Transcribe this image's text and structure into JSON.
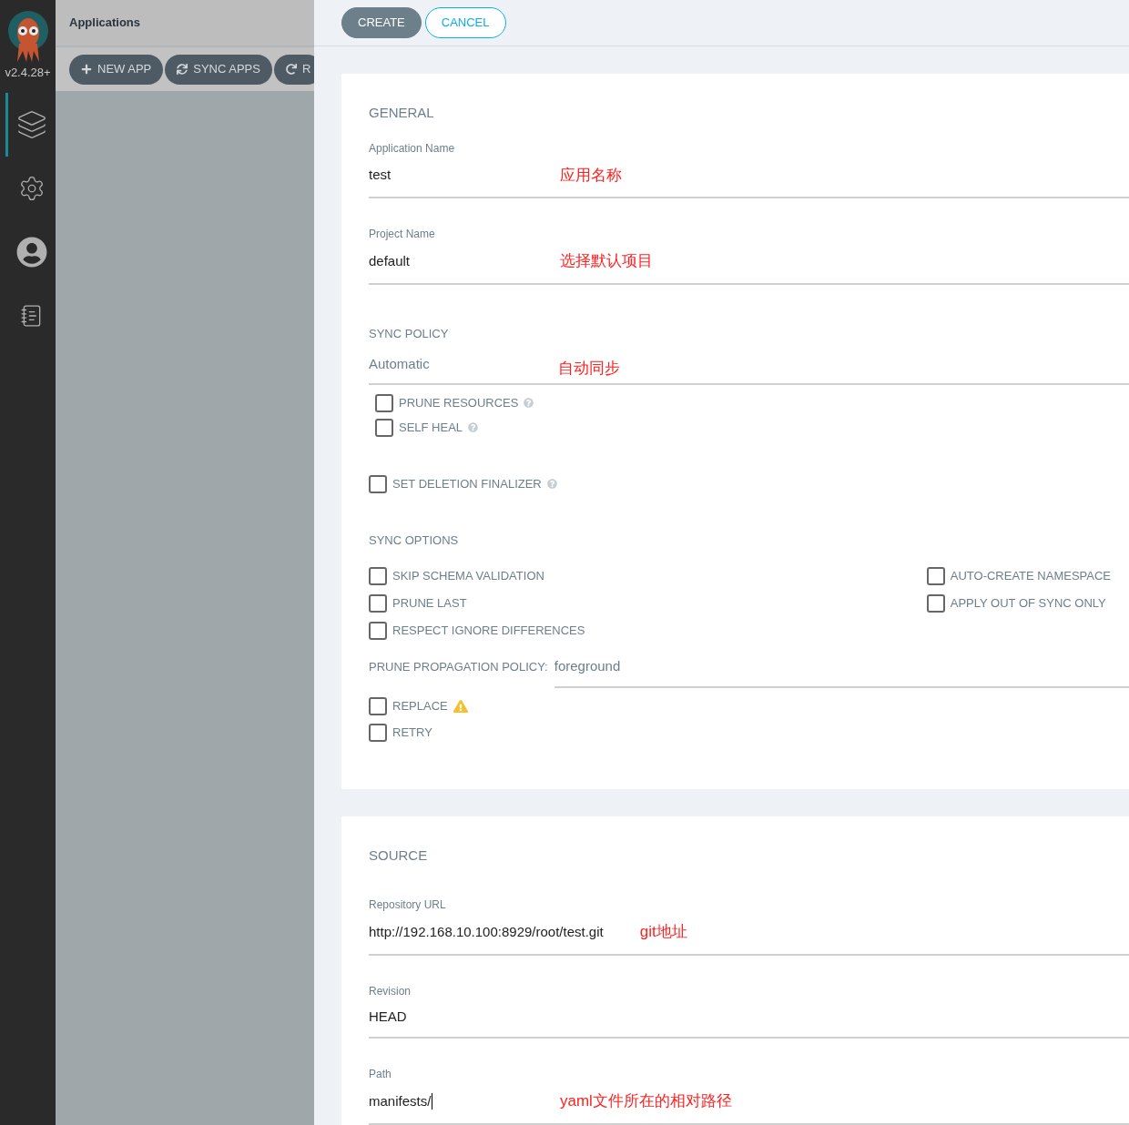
{
  "sidebar": {
    "version": "v2.4.28+",
    "nav_items": [
      {
        "kind": "layers",
        "selected": true
      },
      {
        "kind": "settings",
        "selected": false
      },
      {
        "kind": "user",
        "selected": false
      },
      {
        "kind": "docs",
        "selected": false
      }
    ]
  },
  "header": {
    "title": "Applications",
    "toolbar": [
      {
        "kind": "plus",
        "label": "NEW APP"
      },
      {
        "kind": "sync",
        "label": "SYNC APPS"
      },
      {
        "kind": "refresh",
        "label": "R"
      }
    ]
  },
  "actions": [
    {
      "kind": "primary",
      "label": "CREATE"
    },
    {
      "kind": "outline",
      "label": "CANCEL"
    }
  ],
  "general": {
    "title": "GENERAL",
    "fields": [
      {
        "label": "Application Name",
        "value": "test",
        "note": "应用名称",
        "focused": false
      },
      {
        "label": "Project Name",
        "value": "default",
        "note": "选择默认项目",
        "focused": false
      }
    ]
  },
  "sync_policy": {
    "title": "SYNC POLICY",
    "value": "Automatic",
    "note": "自动同步",
    "options": [
      {
        "label": "PRUNE RESOURCES",
        "checked": false
      },
      {
        "label": "SELF HEAL",
        "checked": false
      }
    ],
    "finalizer": {
      "label": "SET DELETION FINALIZER",
      "checked": false
    }
  },
  "sync_options": {
    "title": "SYNC OPTIONS",
    "left": [
      {
        "label": "SKIP SCHEMA VALIDATION",
        "checked": false
      },
      {
        "label": "PRUNE LAST",
        "checked": false
      },
      {
        "label": "RESPECT IGNORE DIFFERENCES",
        "checked": false
      }
    ],
    "right": [
      {
        "label": "AUTO-CREATE NAMESPACE",
        "checked": false
      },
      {
        "label": "APPLY OUT OF SYNC ONLY",
        "checked": false
      }
    ],
    "prune_policy": {
      "label": "PRUNE PROPAGATION POLICY:",
      "value": "foreground"
    },
    "extra": [
      {
        "label": "REPLACE",
        "checked": false,
        "warning": true
      },
      {
        "label": "RETRY",
        "checked": false,
        "warning": false
      }
    ]
  },
  "source": {
    "title": "SOURCE",
    "fields": [
      {
        "label": "Repository URL",
        "value": "http://192.168.10.100:8929/root/test.git",
        "note": "git地址",
        "focused": false
      },
      {
        "label": "Revision",
        "value": "HEAD",
        "focused": false
      },
      {
        "label": "Path",
        "value": "manifests/",
        "note": "yaml文件所在的相对路径",
        "focused": true
      }
    ]
  }
}
